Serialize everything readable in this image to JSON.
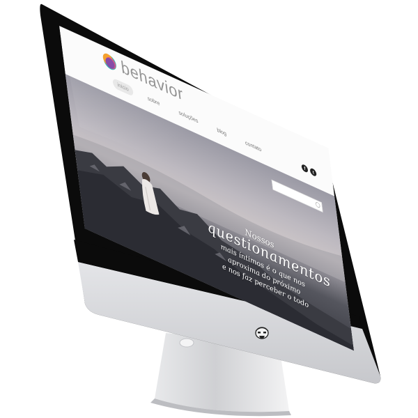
{
  "site": {
    "brand": "behavior",
    "nav": [
      "inicio",
      "sobre",
      "soluções",
      "blog",
      "contato"
    ],
    "social": [
      "f",
      "t"
    ],
    "search": {
      "value": "",
      "placeholder": ""
    },
    "quote": {
      "line1": "Nossos",
      "line2": "questionamentos",
      "line3": "mais íntimos é o que nos",
      "line4": "aproxima do próximo",
      "line5": "e nos faz perceber o todo"
    }
  },
  "colors": {
    "bezel": "#0b0b0b",
    "chin": "#d9dadd",
    "stand": "#cfd0d3",
    "logo_purple": "#7e3fa2",
    "logo_orange": "#f39a1f",
    "logo_teal": "#27b2b3",
    "logo_pink": "#e0457b"
  },
  "icons": {
    "apple_logo": "stormtrooper-icon",
    "search": "search-icon"
  }
}
